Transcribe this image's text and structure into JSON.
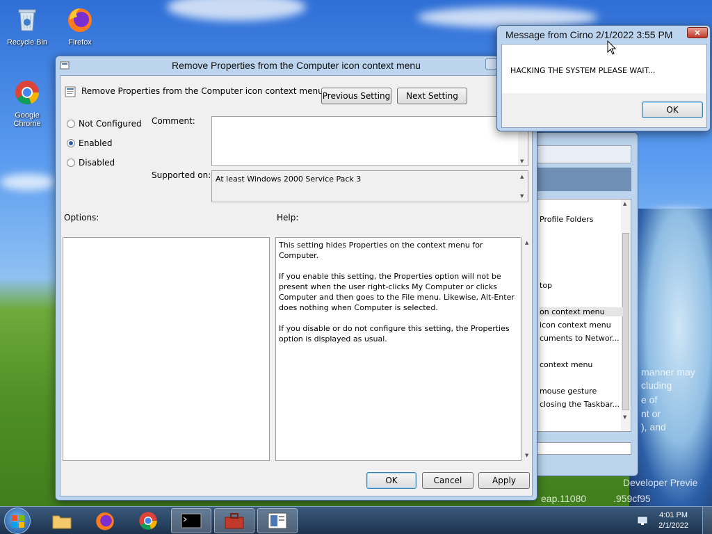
{
  "desktop": {
    "icons": [
      {
        "label": "Recycle Bin"
      },
      {
        "label": "Firefox"
      },
      {
        "label": "Google Chrome"
      }
    ],
    "watermark": {
      "line1": "Developer Previe",
      "line2": "eap.11080",
      "line3": ".959cf95"
    },
    "overlay_fragments": [
      "manner may",
      "cluding",
      "e of",
      "nt or",
      "), and"
    ]
  },
  "policy_window": {
    "title": "Remove Properties from the Computer icon context menu",
    "header_title": "Remove Properties from the Computer icon context menu",
    "previous_button": "Previous Setting",
    "next_button": "Next Setting",
    "options": [
      {
        "label": "Not Configured",
        "selected": false
      },
      {
        "label": "Enabled",
        "selected": true
      },
      {
        "label": "Disabled",
        "selected": false
      }
    ],
    "comment_label": "Comment:",
    "comment_value": "",
    "supported_label": "Supported on:",
    "supported_value": "At least Windows 2000 Service Pack 3",
    "options_label": "Options:",
    "help_label": "Help:",
    "help_paragraphs": [
      "This setting hides Properties on the context menu for Computer.",
      "If you enable this setting, the Properties option will not be present when the user right-clicks My Computer or clicks Computer and then goes to the File menu.  Likewise, Alt-Enter does nothing when Computer is selected.",
      "If you disable or do not configure this setting, the Properties option is displayed as usual."
    ],
    "ok_button": "OK",
    "cancel_button": "Cancel",
    "apply_button": "Apply"
  },
  "message_box": {
    "title": "Message from Cirno 2/1/2022 3:55 PM",
    "message": "HACKING THE SYSTEM PLEASE WAIT...",
    "ok_button": "OK"
  },
  "background_window": {
    "items": [
      "Profile Folders",
      "top",
      "on context menu",
      "icon context menu",
      "cuments to Networ...",
      "context menu",
      "mouse gesture",
      "closing the Taskbar..."
    ]
  },
  "taskbar": {
    "time": "4:01 PM",
    "date": "2/1/2022",
    "buttons": [
      "File Explorer",
      "Firefox",
      "Google Chrome",
      "Command Prompt",
      "Toolbox",
      "Group Policy Editor"
    ]
  }
}
